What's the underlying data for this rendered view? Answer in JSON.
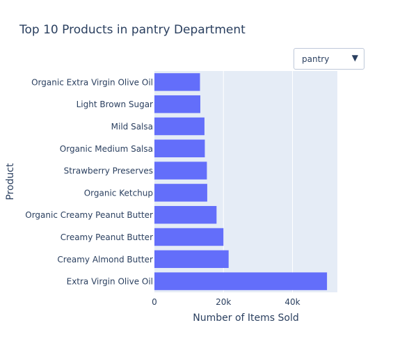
{
  "colors": {
    "plot_bg": "#e5ecf6",
    "bar": "#636efa",
    "text": "#2a3f5f",
    "grid": "#ffffff"
  },
  "dropdown": {
    "selected": "pantry",
    "icon": "caret-down-icon"
  },
  "chart_data": {
    "type": "bar",
    "orientation": "horizontal",
    "title": "Top 10 Products in pantry Department",
    "xlabel": "Number of Items Sold",
    "ylabel": "Product",
    "xlim": [
      0,
      53000
    ],
    "xticks": [
      {
        "value": 0,
        "label": "0"
      },
      {
        "value": 20000,
        "label": "20k"
      },
      {
        "value": 40000,
        "label": "40k"
      }
    ],
    "grid": true,
    "categories": [
      "Organic Extra Virgin Olive Oil",
      "Light Brown Sugar",
      "Mild Salsa",
      "Organic Medium Salsa",
      "Strawberry Preserves",
      "Organic Ketchup",
      "Organic Creamy Peanut Butter",
      "Creamy Peanut Butter",
      "Creamy Almond Butter",
      "Extra Virgin Olive Oil"
    ],
    "values": [
      13200,
      13300,
      14500,
      14600,
      15200,
      15300,
      18000,
      20000,
      21500,
      50000
    ]
  }
}
